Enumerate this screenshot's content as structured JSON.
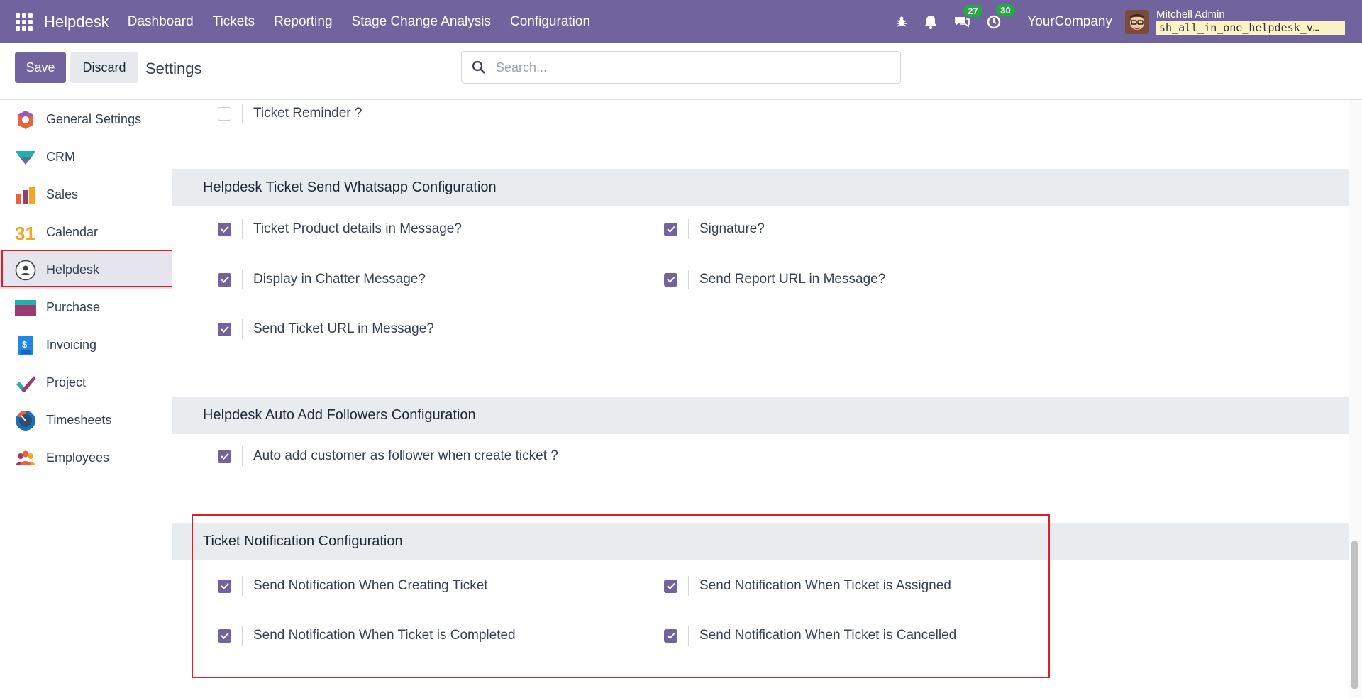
{
  "navbar": {
    "brand": "Helpdesk",
    "menu": [
      "Dashboard",
      "Tickets",
      "Reporting",
      "Stage Change Analysis",
      "Configuration"
    ],
    "chat_count": "27",
    "activity_count": "30",
    "company": "YourCompany",
    "user_name": "Mitchell Admin",
    "database": "sh_all_in_one_helpdesk_v…"
  },
  "control": {
    "save_label": "Save",
    "discard_label": "Discard",
    "title": "Settings",
    "search_placeholder": "Search..."
  },
  "sidebar": {
    "items": [
      {
        "label": "General Settings",
        "icon": "general-settings-icon"
      },
      {
        "label": "CRM",
        "icon": "crm-icon"
      },
      {
        "label": "Sales",
        "icon": "sales-icon"
      },
      {
        "label": "Calendar",
        "icon": "calendar-icon"
      },
      {
        "label": "Helpdesk",
        "icon": "helpdesk-icon",
        "active": true
      },
      {
        "label": "Purchase",
        "icon": "purchase-icon"
      },
      {
        "label": "Invoicing",
        "icon": "invoicing-icon"
      },
      {
        "label": "Project",
        "icon": "project-icon"
      },
      {
        "label": "Timesheets",
        "icon": "timesheets-icon"
      },
      {
        "label": "Employees",
        "icon": "employees-icon"
      }
    ],
    "calendar_number": "31",
    "invoice_symbol": "$"
  },
  "settings": {
    "ticket_reminder": {
      "label": "Ticket Reminder ?",
      "checked": false
    },
    "whatsapp": {
      "title": "Helpdesk Ticket Send Whatsapp Configuration",
      "items": [
        {
          "label": "Ticket Product details in Message?",
          "checked": true
        },
        {
          "label": "Signature?",
          "checked": true
        },
        {
          "label": "Display in Chatter Message?",
          "checked": true
        },
        {
          "label": "Send Report URL in Message?",
          "checked": true
        },
        {
          "label": "Send Ticket URL in Message?",
          "checked": true
        }
      ]
    },
    "followers": {
      "title": "Helpdesk Auto Add Followers Configuration",
      "items": [
        {
          "label": "Auto add customer as follower when create ticket ?",
          "checked": true
        }
      ]
    },
    "notification": {
      "title": "Ticket Notification Configuration",
      "items": [
        {
          "label": "Send Notification When Creating Ticket",
          "checked": true
        },
        {
          "label": "Send Notification When Ticket is Assigned",
          "checked": true
        },
        {
          "label": "Send Notification When Ticket is Completed",
          "checked": true
        },
        {
          "label": "Send Notification When Ticket is Cancelled",
          "checked": true
        }
      ]
    }
  },
  "colors": {
    "brand": "#71639e",
    "highlight": "#e11d2b",
    "badge": "#28a745"
  }
}
